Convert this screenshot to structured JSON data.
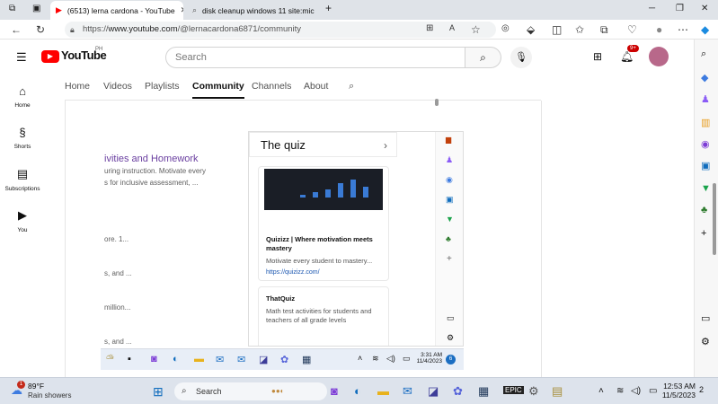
{
  "browser": {
    "tabs": [
      {
        "label": "(6513) lerna cardona - YouTube",
        "active": true
      },
      {
        "label": "disk cleanup windows 11 site:mic",
        "active": false
      }
    ],
    "new_tab": "+",
    "window_controls": {
      "minimize": "─",
      "maximize": "❐",
      "close": "✕"
    },
    "url_scheme": "https://",
    "url_host": "www.youtube.com",
    "url_path": "/@lernacardona6871/community"
  },
  "youtube": {
    "logo_text": "YouTube",
    "logo_region": "PH",
    "search_placeholder": "Search",
    "notification_count": "9+",
    "left_nav": [
      {
        "label": "Home",
        "icon": "home-icon"
      },
      {
        "label": "Shorts",
        "icon": "shorts-icon"
      },
      {
        "label": "Subscriptions",
        "icon": "subscriptions-icon"
      },
      {
        "label": "You",
        "icon": "you-icon"
      }
    ],
    "channel_tabs": [
      "Home",
      "Videos",
      "Playlists",
      "Community",
      "Channels",
      "About"
    ],
    "selected_tab": "Community"
  },
  "post": {
    "title_fragment": "ivities and Homework",
    "line1": "uring instruction. Motivate every",
    "line2": "s for inclusive assessment, ...",
    "snippet1": "ore. 1...",
    "snippet2": "s, and ...",
    "snippet3": "million...",
    "snippet4": "s, and ..."
  },
  "popup": {
    "header": "The quiz",
    "cards": [
      {
        "title": "Quizizz | Where motivation meets mastery",
        "desc": "Motivate every student to mastery...",
        "link": "https://quizizz.com/"
      },
      {
        "title": "ThatQuiz",
        "desc": "Math test activities for students and teachers of all grade levels",
        "link": ""
      }
    ],
    "inner_time": "3:31 AM",
    "inner_date": "11/4/2023",
    "inner_badge": "6"
  },
  "taskbar": {
    "weather_temp": "89°F",
    "weather_desc": "Rain showers",
    "weather_badge": "1",
    "search_label": "Search",
    "time": "12:53 AM",
    "date": "11/5/2023",
    "notif_count": "2"
  },
  "colors": {
    "youtube_red": "#ff0000",
    "link_blue": "#1a56b0",
    "post_title_purple": "#6a3fa0"
  }
}
